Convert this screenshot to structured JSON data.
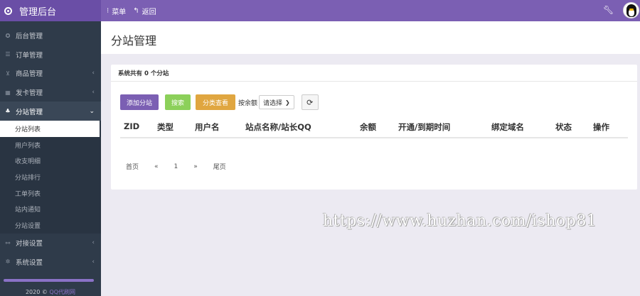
{
  "header": {
    "brand": "管理后台",
    "nav": [
      {
        "icon": "bars-icon",
        "label": "菜单"
      },
      {
        "icon": "return-icon",
        "label": "返回"
      }
    ]
  },
  "sidebar": {
    "items": [
      {
        "icon": "home-icon",
        "label": "后台管理",
        "has_submenu": false
      },
      {
        "icon": "list-icon",
        "label": "订单管理",
        "has_submenu": false
      },
      {
        "icon": "cart-icon",
        "label": "商品管理",
        "has_submenu": true
      },
      {
        "icon": "grid-icon",
        "label": "发卡管理",
        "has_submenu": true
      },
      {
        "icon": "sitemap-icon",
        "label": "分站管理",
        "has_submenu": true,
        "expanded": true
      }
    ],
    "submenu": [
      "分站列表",
      "用户列表",
      "收支明细",
      "分站排行",
      "工单列表",
      "站内通知",
      "分站设置"
    ],
    "bottom_items": [
      {
        "icon": "link-icon",
        "label": "对接设置",
        "has_submenu": true
      },
      {
        "icon": "cog-icon",
        "label": "系统设置",
        "has_submenu": true
      }
    ],
    "copyright_year": "2020 ©",
    "copyright_link": "QQ代刷网"
  },
  "page": {
    "title": "分站管理"
  },
  "panel": {
    "summary": "系统共有 0 个分站",
    "buttons": {
      "add": "添加分站",
      "search": "搜索",
      "category": "分类查看"
    },
    "sort_label": "按余额",
    "select_value": "请选择",
    "table_headers": [
      "ZID",
      "类型",
      "用户名",
      "站点名称/站长QQ",
      "余额",
      "开通/到期时间",
      "绑定域名",
      "状态",
      "操作"
    ],
    "pager": [
      "首页",
      "«",
      "1",
      "»",
      "尾页"
    ]
  },
  "watermark": "https://www.huzhan.com/ishop81",
  "colors": {
    "accent": "#7b5fb3",
    "sidebar": "#2f3b4a",
    "search_btn": "#8cd05a",
    "category_btn": "#e0a640"
  }
}
